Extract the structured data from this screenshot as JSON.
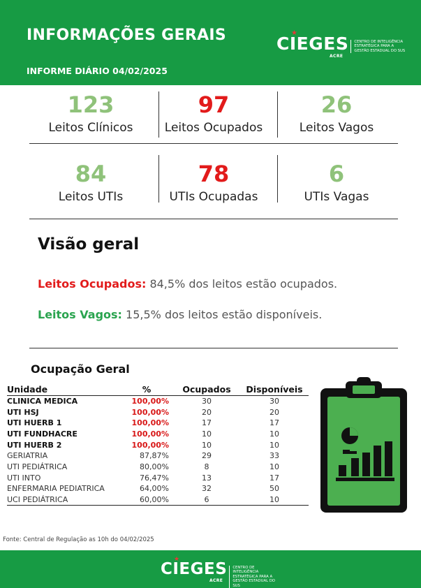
{
  "header": {
    "title": "INFORMAÇÕES GERAIS",
    "subtitle": "INFORME DIÁRIO 04/02/2025",
    "background_color": "#179b44"
  },
  "logo": {
    "name": "CIEGES",
    "region": "ACRE",
    "description": "CENTRO DE INTELIGÊNCIA ESTRATÉGICA PARA A GESTÃO ESTADUAL DO SUS"
  },
  "stats_row1": [
    {
      "value": "123",
      "label": "Leitos Clínicos",
      "color": "#8fc27a"
    },
    {
      "value": "97",
      "label": "Leitos Ocupados",
      "color": "#e21b1b"
    },
    {
      "value": "26",
      "label": "Leitos Vagos",
      "color": "#8fc27a"
    }
  ],
  "stats_row2": [
    {
      "value": "84",
      "label": "Leitos UTIs",
      "color": "#8fc27a"
    },
    {
      "value": "78",
      "label": "UTIs Ocupadas",
      "color": "#e21b1b"
    },
    {
      "value": "6",
      "label": "UTIs Vagas",
      "color": "#8fc27a"
    }
  ],
  "overview": {
    "title": "Visão geral",
    "occupied_key": "Leitos Ocupados:",
    "occupied_text": " 84,5% dos leitos estão ocupados.",
    "vacant_key": "Leitos Vagos:",
    "vacant_text": " 15,5% dos leitos estão disponíveis.",
    "occupied_color": "#e21b1b",
    "vacant_color": "#2aa44f"
  },
  "occupancy": {
    "title": "Ocupação Geral",
    "columns": [
      "Unidade",
      "%",
      "Ocupados",
      "Disponíveis"
    ],
    "rows": [
      {
        "unit": "CLINICA MEDICA",
        "pct": "100,00%",
        "occupied": "30",
        "available": "30",
        "highlight": true
      },
      {
        "unit": "UTI HSJ",
        "pct": "100,00%",
        "occupied": "20",
        "available": "20",
        "highlight": true
      },
      {
        "unit": "UTI HUERB 1",
        "pct": "100,00%",
        "occupied": "17",
        "available": "17",
        "highlight": true
      },
      {
        "unit": "UTI FUNDHACRE",
        "pct": "100,00%",
        "occupied": "10",
        "available": "10",
        "highlight": true
      },
      {
        "unit": "UTI HUERB 2",
        "pct": "100,00%",
        "occupied": "10",
        "available": "10",
        "highlight": true
      },
      {
        "unit": "GERIATRIA",
        "pct": "87,87%",
        "occupied": "29",
        "available": "33",
        "highlight": false
      },
      {
        "unit": "UTI PEDIÁTRICA",
        "pct": "80,00%",
        "occupied": "8",
        "available": "10",
        "highlight": false
      },
      {
        "unit": "UTI INTO",
        "pct": "76,47%",
        "occupied": "13",
        "available": "17",
        "highlight": false
      },
      {
        "unit": "ENFERMARIA PEDIATRICA",
        "pct": "64,00%",
        "occupied": "32",
        "available": "50",
        "highlight": false
      },
      {
        "unit": "UCI PEDIÁTRICA",
        "pct": "60,00%",
        "occupied": "6",
        "available": "10",
        "highlight": false
      }
    ]
  },
  "icon": "clipboard-chart-icon",
  "source": "Fonte: Central de Regulação as 10h do 04/02/2025",
  "footer": {
    "background_color": "#179b44"
  }
}
